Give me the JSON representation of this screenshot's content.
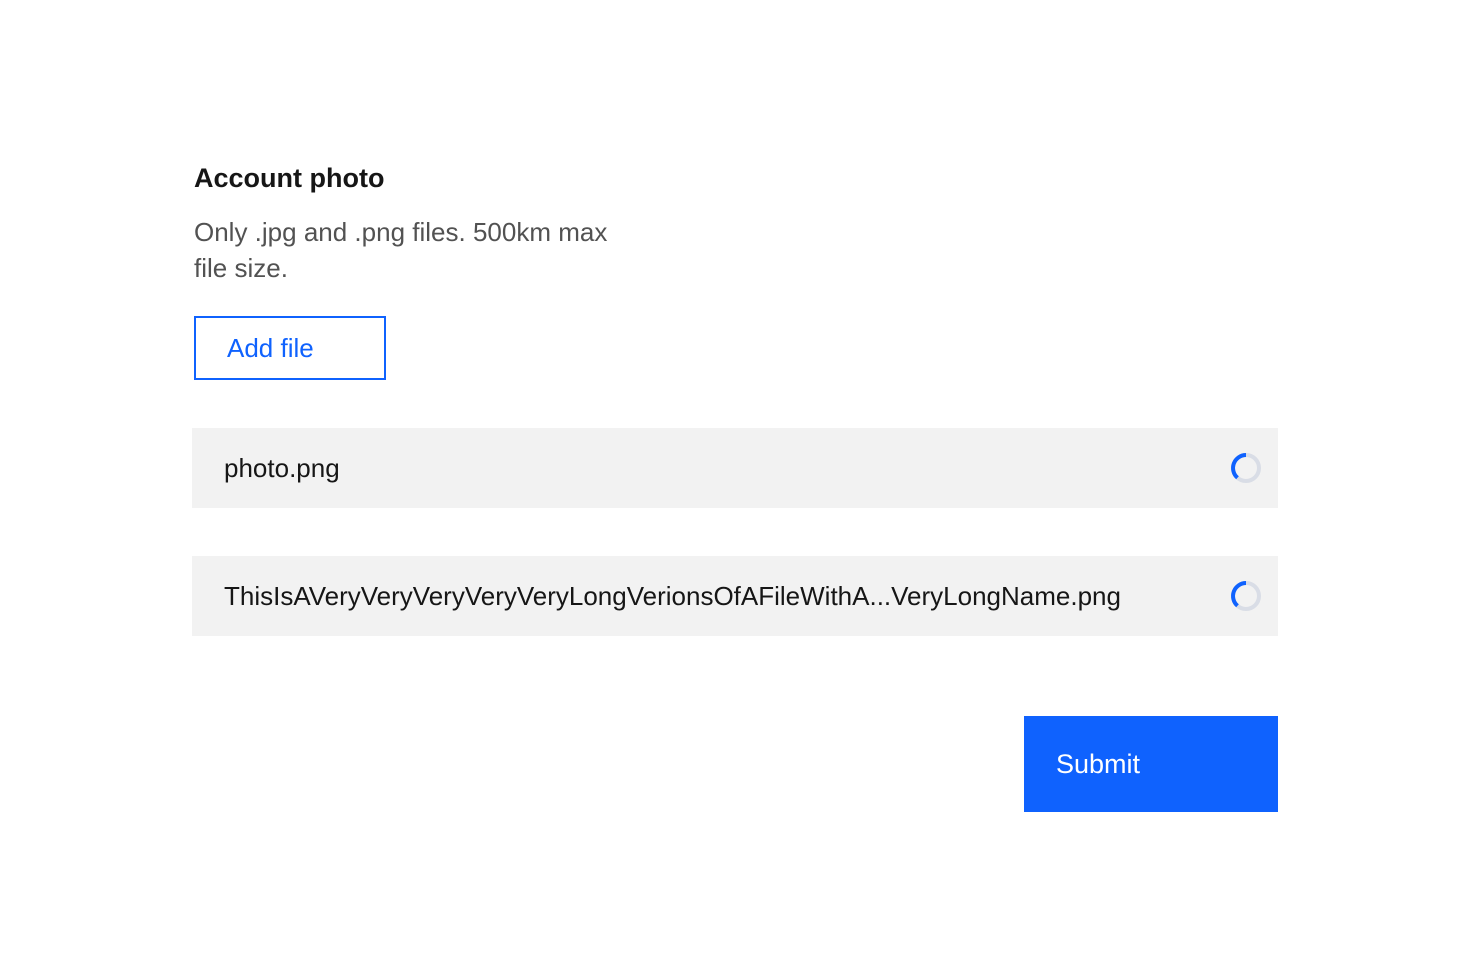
{
  "uploader": {
    "title": "Account photo",
    "description": "Only .jpg and .png files. 500km max file size.",
    "add_file_label": "Add file",
    "files": [
      {
        "name": "photo.png",
        "status": "uploading"
      },
      {
        "name": "ThisIsAVeryVeryVeryVeryVeryLongVerionsOfAFileWithA...VeryLongName.png",
        "status": "uploading"
      }
    ],
    "loading_icon": "loading-spinner-icon"
  },
  "form": {
    "submit_label": "Submit"
  },
  "colors": {
    "primary": "#0f62fe",
    "row_background": "#f2f2f2",
    "text_primary": "#161616",
    "text_secondary": "#525252",
    "spinner_track": "#d9dde6"
  }
}
